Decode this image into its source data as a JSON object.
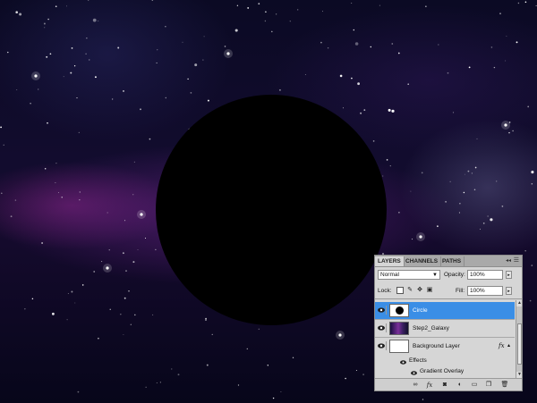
{
  "layers_panel": {
    "tabs": [
      {
        "label": "LAYERS",
        "active": true
      },
      {
        "label": "CHANNELS",
        "active": false
      },
      {
        "label": "PATHS",
        "active": false
      }
    ],
    "blend_mode": "Normal",
    "opacity_label": "Opacity:",
    "opacity_value": "100%",
    "lock_label": "Lock:",
    "fill_label": "Fill:",
    "fill_value": "100%",
    "layers": [
      {
        "name": "Circle",
        "selected": true,
        "thumbnail": "black-circle"
      },
      {
        "name": "Step2_Galaxy",
        "selected": false,
        "thumbnail": "galaxy"
      },
      {
        "name": "Background Layer",
        "selected": false,
        "thumbnail": "white",
        "fx": "fx"
      }
    ],
    "effects_label": "Effects",
    "effect_items": [
      "Gradient Overlay"
    ],
    "selection_color": "#3a8ee6"
  }
}
